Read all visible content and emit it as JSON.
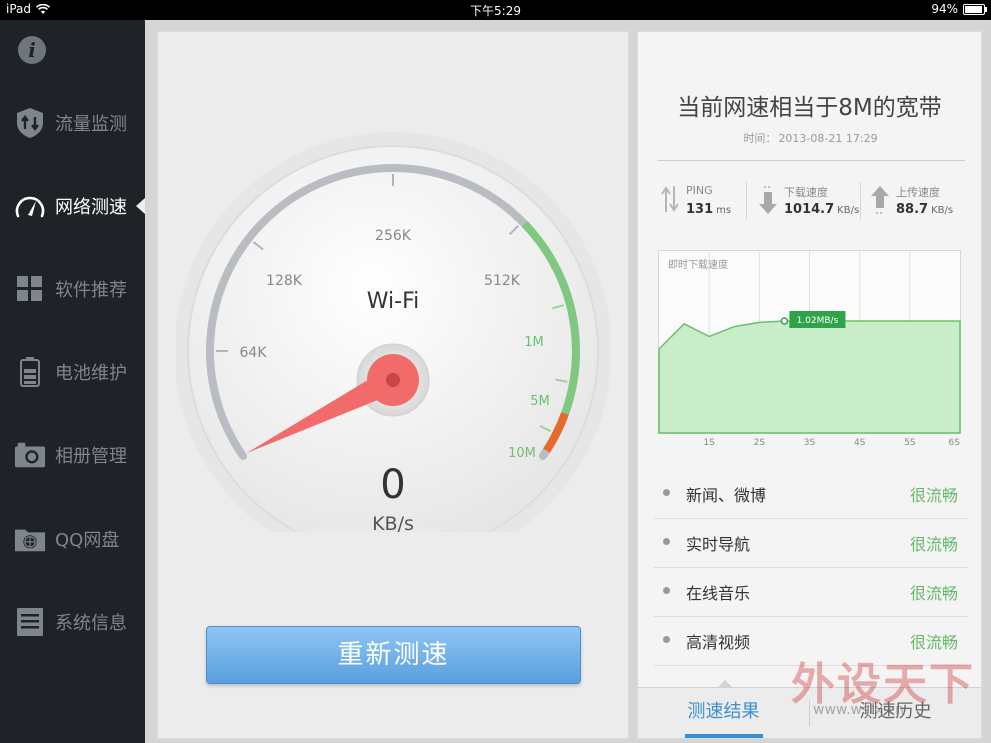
{
  "status_bar": {
    "device": "iPad",
    "time": "下午5:29",
    "battery": "94%",
    "battery_level": 0.94
  },
  "sidebar": {
    "items": [
      {
        "label": "流量监测",
        "icon": "shield-arrows-icon"
      },
      {
        "label": "网络测速",
        "icon": "speedometer-icon",
        "active": true
      },
      {
        "label": "软件推荐",
        "icon": "grid-icon"
      },
      {
        "label": "电池维护",
        "icon": "battery-icon"
      },
      {
        "label": "相册管理",
        "icon": "camera-icon"
      },
      {
        "label": "QQ网盘",
        "icon": "folder-globe-icon"
      },
      {
        "label": "系统信息",
        "icon": "document-icon"
      }
    ]
  },
  "gauge": {
    "connection": "Wi-Fi",
    "speed_value": "0",
    "speed_unit": "KB/s",
    "ticks": [
      "64K",
      "128K",
      "256K",
      "512K",
      "1M",
      "5M",
      "10M"
    ],
    "needle_value": 0,
    "accent_color": "#6cc06e",
    "needle_color": "#f26b6b"
  },
  "retest_button": "重新测速",
  "result": {
    "headline": "当前网速相当于8M的宽带",
    "time_label": "时间：",
    "time_value": "2013-08-21 17:29",
    "metrics": {
      "ping": {
        "label": "PING",
        "value": "131",
        "unit": "ms"
      },
      "download": {
        "label": "下载速度",
        "value": "1014.7",
        "unit": "KB/s"
      },
      "upload": {
        "label": "上传速度",
        "value": "88.7",
        "unit": "KB/s"
      }
    },
    "apps": [
      {
        "name": "新闻、微博",
        "status": "很流畅"
      },
      {
        "name": "实时导航",
        "status": "很流畅"
      },
      {
        "name": "在线音乐",
        "status": "很流畅"
      },
      {
        "name": "高清视频",
        "status": "很流畅"
      }
    ],
    "tabs": {
      "results": "测速结果",
      "history": "测速历史"
    }
  },
  "chart_data": {
    "type": "area",
    "title": "即时下载速度",
    "x_ticks": [
      "1S",
      "2S",
      "3S",
      "4S",
      "5S",
      "6S"
    ],
    "x": [
      0,
      0.5,
      1,
      1.5,
      2,
      2.5,
      3,
      3.5,
      4,
      4.5,
      5,
      5.5,
      6
    ],
    "values": [
      0.6,
      0.78,
      0.69,
      0.76,
      0.79,
      0.8,
      0.8,
      0.8,
      0.8,
      0.8,
      0.8,
      0.8,
      0.8
    ],
    "xlim": [
      0,
      6
    ],
    "ylim": [
      0,
      1.3
    ],
    "annotation": {
      "x": 2.5,
      "y": 0.8,
      "label": "1.02MB/s"
    },
    "grid": true,
    "fill_color": "#c9ecc9",
    "line_color": "#6cc06e"
  },
  "watermark": {
    "text": "外设天下",
    "url": "www.wstx.cn"
  }
}
